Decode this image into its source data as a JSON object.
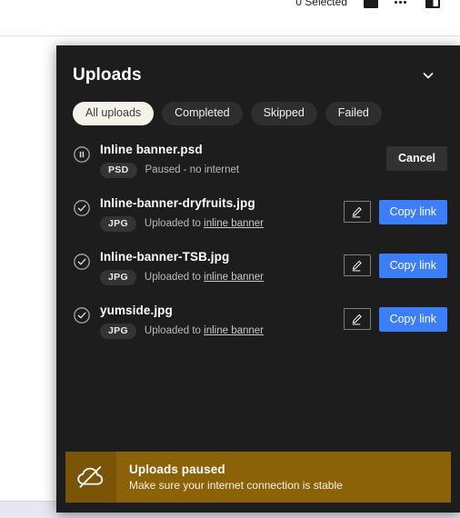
{
  "background": {
    "toolbar": {
      "selected_count_label": "0 Selected",
      "icons": [
        "share-icon",
        "more-options-icon",
        "details-panel-icon"
      ]
    }
  },
  "dialog": {
    "title": "Uploads",
    "collapse_icon": "chevron-down-icon",
    "filters": [
      {
        "label": "All uploads",
        "active": true
      },
      {
        "label": "Completed",
        "active": false
      },
      {
        "label": "Skipped",
        "active": false
      },
      {
        "label": "Failed",
        "active": false
      }
    ],
    "files": [
      {
        "name": "Inline banner.psd",
        "type": "PSD",
        "status_icon": "pause-circle-icon",
        "status_text": "Paused - no internet",
        "link_text": "",
        "actions": [
          {
            "kind": "cancel",
            "label": "Cancel"
          }
        ]
      },
      {
        "name": "Inline-banner-dryfruits.jpg",
        "type": "JPG",
        "status_icon": "check-circle-icon",
        "status_text": "Uploaded to",
        "link_text": "inline banner",
        "actions": [
          {
            "kind": "edit",
            "label": ""
          },
          {
            "kind": "copy",
            "label": "Copy link"
          }
        ]
      },
      {
        "name": "Inline-banner-TSB.jpg",
        "type": "JPG",
        "status_icon": "check-circle-icon",
        "status_text": "Uploaded to",
        "link_text": "inline banner",
        "actions": [
          {
            "kind": "edit",
            "label": ""
          },
          {
            "kind": "copy",
            "label": "Copy link"
          }
        ]
      },
      {
        "name": "yumside.jpg",
        "type": "JPG",
        "status_icon": "check-circle-icon",
        "status_text": "Uploaded to",
        "link_text": "inline banner",
        "actions": [
          {
            "kind": "edit",
            "label": ""
          },
          {
            "kind": "copy",
            "label": "Copy link"
          }
        ]
      }
    ],
    "alert": {
      "icon": "cloud-offline-icon",
      "title": "Uploads paused",
      "subtitle": "Make sure your internet connection is stable",
      "color": "#8c6209"
    }
  },
  "colors": {
    "dialog_bg": "#1d1d1d",
    "accent_blue": "#3b7ef7",
    "alert_brown": "#8c6209",
    "chip_active_bg": "#f5f2ea"
  }
}
